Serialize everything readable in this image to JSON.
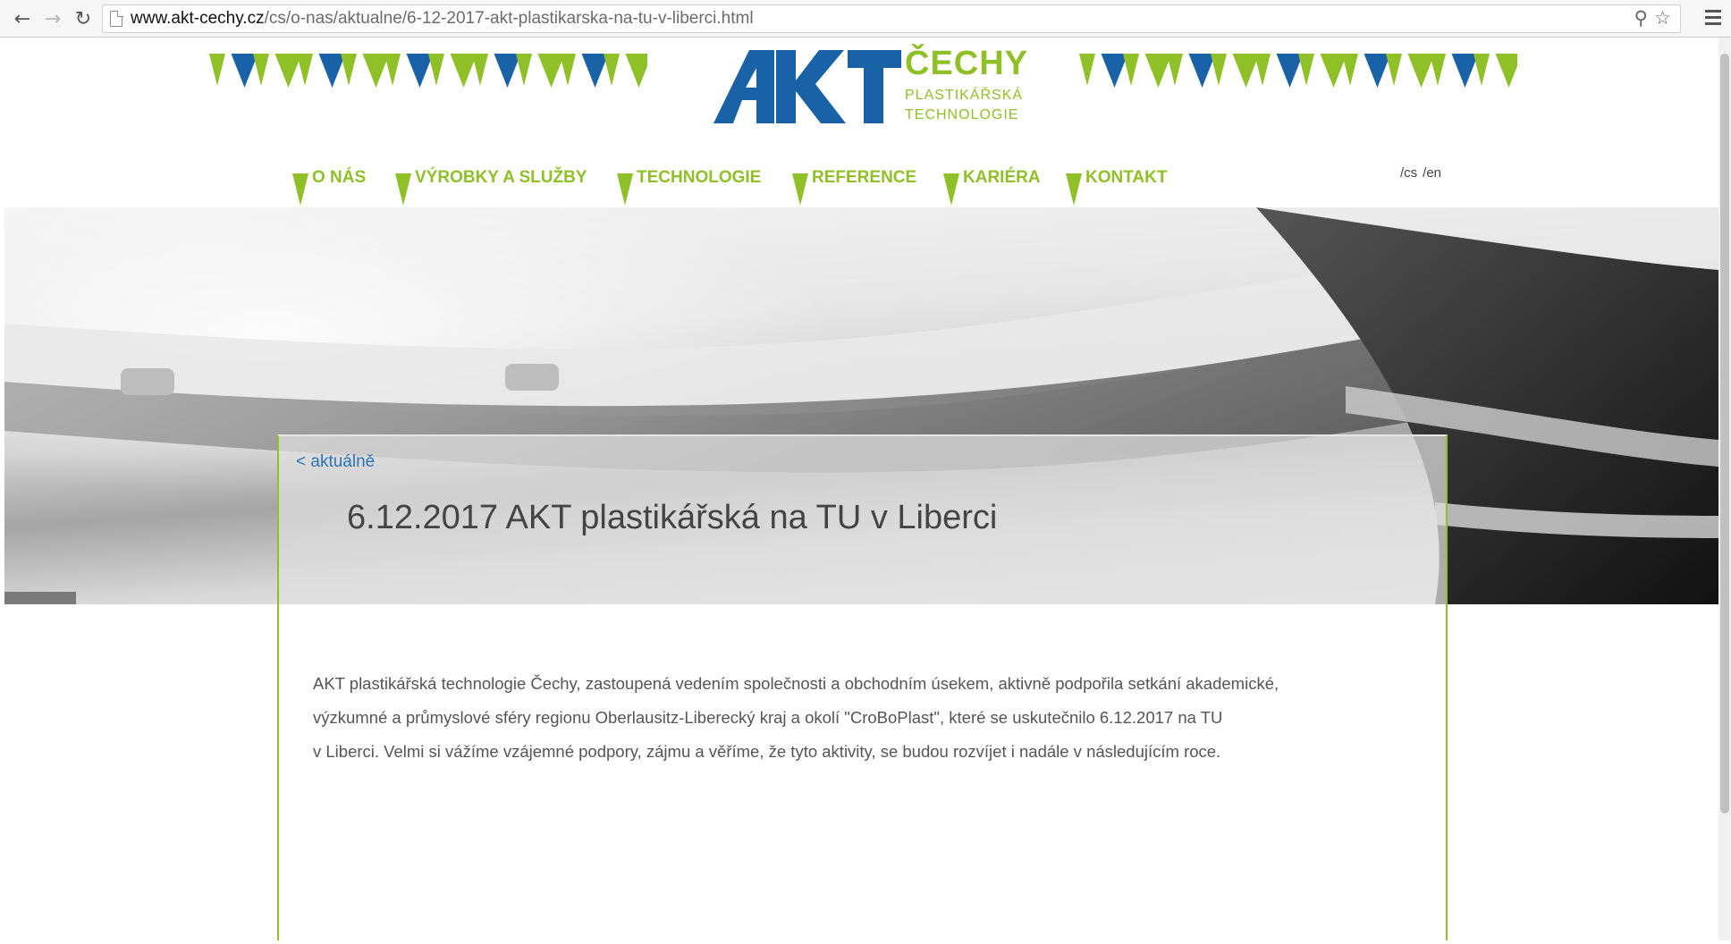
{
  "browser": {
    "url_host": "www.akt-cechy.cz",
    "url_path": "/cs/o-nas/aktualne/6-12-2017-akt-plastikarska-na-tu-v-liberci.html",
    "back_icon": "arrow-left-icon",
    "forward_icon": "arrow-right-icon",
    "reload_icon": "reload-icon",
    "zoom_icon": "zoom-icon",
    "star_icon": "star-icon",
    "menu_icon": "menu-icon"
  },
  "logo": {
    "wordmark": "AKT",
    "name": "ČECHY",
    "line1": "PLASTIKÁŘSKÁ",
    "line2": "TECHNOLOGIE",
    "blue": "#1a62a8",
    "green": "#8fc027"
  },
  "nav": {
    "items": [
      {
        "label": "O NÁS"
      },
      {
        "label": "VÝROBKY A SLUŽBY"
      },
      {
        "label": "TECHNOLOGIE"
      },
      {
        "label": "REFERENCE"
      },
      {
        "label": "KARIÉRA"
      },
      {
        "label": "KONTAKT"
      }
    ]
  },
  "lang": {
    "cs": "/cs",
    "en": "/en"
  },
  "article": {
    "back_link": "< aktuálně",
    "title": "6.12.2017 AKT plastikářská na TU v Liberci",
    "lines": [
      "AKT plastikářská technologie Čechy, zastoupená vedením společnosti a obchodním úsekem, aktivně podpořila setkání akademické,",
      "výzkumné a průmyslové sféry regionu Oberlausitz-Liberecký kraj a okolí \"CroBoPlast\", které se uskutečnilo 6.12.2017 na TU",
      "v Liberci. Velmi si vážíme vzájemné podpory, zájmu a věříme, že tyto aktivity, se budou rozvíjet i nadále v následujícím roce."
    ]
  },
  "colors": {
    "accent_green": "#8fc027",
    "brand_blue": "#1a62a8",
    "link_blue": "#2d74b6"
  }
}
